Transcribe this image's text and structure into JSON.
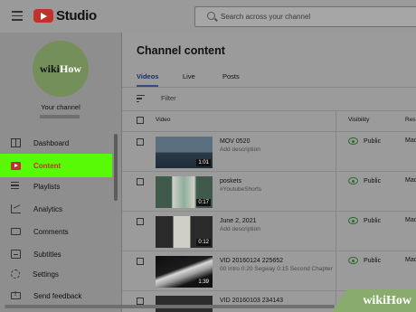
{
  "header": {
    "logo_text": "Studio",
    "search_placeholder": "Search across your channel"
  },
  "sidebar": {
    "avatar_text_a": "wiki",
    "avatar_text_b": "How",
    "channel_label": "Your channel",
    "items": [
      {
        "label": "Dashboard",
        "icon": "dashboard-icon"
      },
      {
        "label": "Content",
        "icon": "content-icon",
        "active": true
      },
      {
        "label": "Playlists",
        "icon": "playlists-icon"
      },
      {
        "label": "Analytics",
        "icon": "analytics-icon"
      },
      {
        "label": "Comments",
        "icon": "comments-icon"
      },
      {
        "label": "Subtitles",
        "icon": "subtitles-icon"
      },
      {
        "label": "Settings",
        "icon": "gear-icon"
      },
      {
        "label": "Send feedback",
        "icon": "feedback-icon"
      }
    ]
  },
  "main": {
    "title": "Channel content",
    "tabs": [
      "Videos",
      "Live",
      "Posts"
    ],
    "filter_label": "Filter",
    "columns": {
      "video": "Video",
      "visibility": "Visibility",
      "restrictions": "Res"
    },
    "rows": [
      {
        "title": "MOV 0520",
        "description": "Add description",
        "duration": "1:01",
        "visibility": "Public",
        "restrictions": "Made"
      },
      {
        "title": "poskets",
        "description": "#YoutubeShorts",
        "duration": "0:17",
        "visibility": "Public",
        "restrictions": "Made"
      },
      {
        "title": "June 2, 2021",
        "description": "Add description",
        "duration": "0:12",
        "visibility": "Public",
        "restrictions": "Made"
      },
      {
        "title": "VID 20160124 225652",
        "description": "00 Intro 0:20 Segway 0:15 Second Chapter",
        "duration": "1:39",
        "visibility": "Public",
        "restrictions": "Made"
      },
      {
        "title": "VID 20160103 234143",
        "description": "",
        "duration": "",
        "visibility": "",
        "restrictions": ""
      }
    ]
  },
  "watermark": {
    "a": "wiki",
    "b": "How"
  },
  "colors": {
    "accent": "#c4302b",
    "highlight": "#59fa06",
    "tab_active": "#2c4d88"
  }
}
